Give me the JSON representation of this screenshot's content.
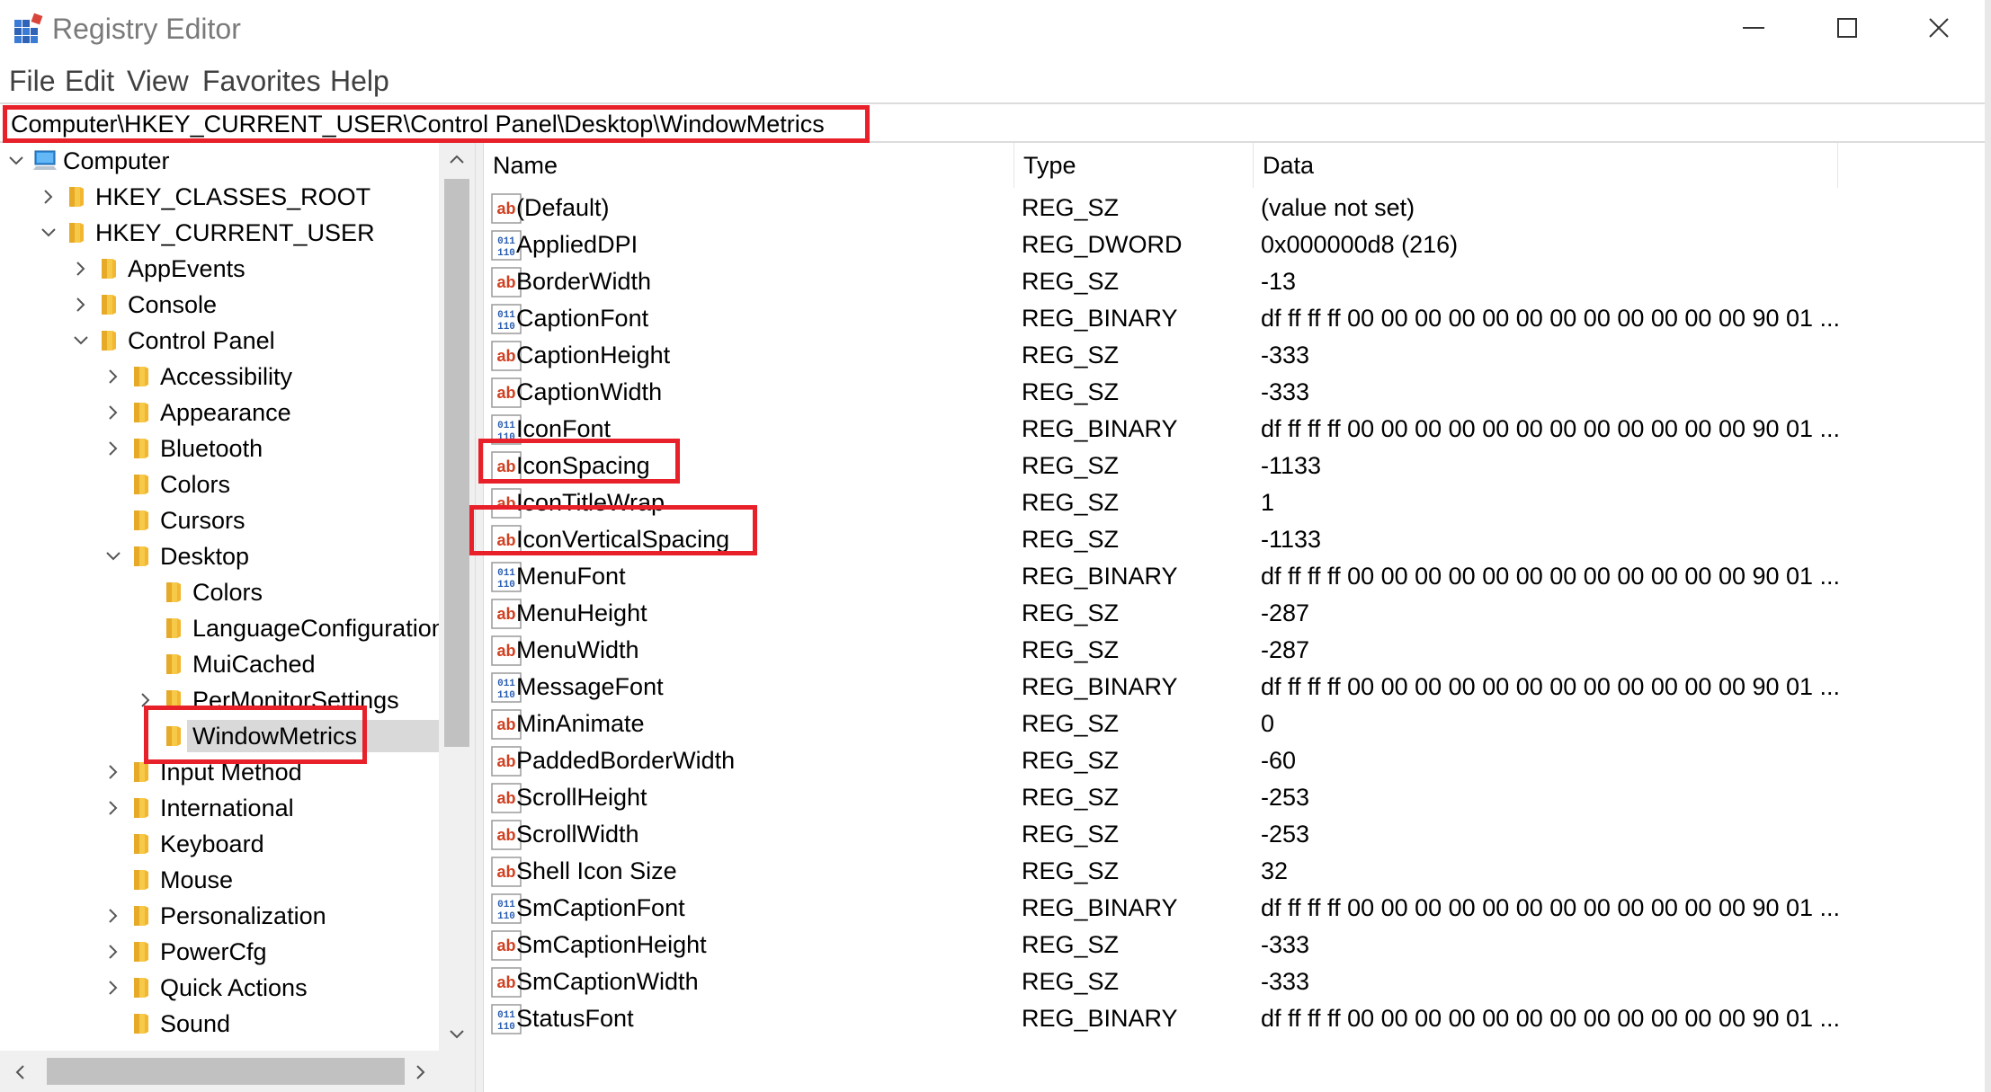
{
  "window": {
    "title": "Registry Editor",
    "accent": "#e8202a"
  },
  "menu": [
    "File",
    "Edit",
    "View",
    "Favorites",
    "Help"
  ],
  "address": "Computer\\HKEY_CURRENT_USER\\Control Panel\\Desktop\\WindowMetrics",
  "tree": [
    {
      "label": "Computer",
      "level": 0,
      "expander": "expanded",
      "icon": "computer-icon"
    },
    {
      "label": "HKEY_CLASSES_ROOT",
      "level": 1,
      "expander": "collapsed",
      "icon": "folder-icon"
    },
    {
      "label": "HKEY_CURRENT_USER",
      "level": 1,
      "expander": "expanded",
      "icon": "folder-icon"
    },
    {
      "label": "AppEvents",
      "level": 2,
      "expander": "collapsed",
      "icon": "folder-icon"
    },
    {
      "label": "Console",
      "level": 2,
      "expander": "collapsed",
      "icon": "folder-icon"
    },
    {
      "label": "Control Panel",
      "level": 2,
      "expander": "expanded",
      "icon": "folder-icon"
    },
    {
      "label": "Accessibility",
      "level": 3,
      "expander": "collapsed",
      "icon": "folder-icon"
    },
    {
      "label": "Appearance",
      "level": 3,
      "expander": "collapsed",
      "icon": "folder-icon"
    },
    {
      "label": "Bluetooth",
      "level": 3,
      "expander": "collapsed",
      "icon": "folder-icon"
    },
    {
      "label": "Colors",
      "level": 3,
      "expander": "none",
      "icon": "folder-icon"
    },
    {
      "label": "Cursors",
      "level": 3,
      "expander": "none",
      "icon": "folder-icon"
    },
    {
      "label": "Desktop",
      "level": 3,
      "expander": "expanded",
      "icon": "folder-icon"
    },
    {
      "label": "Colors",
      "level": 4,
      "expander": "none",
      "icon": "folder-icon"
    },
    {
      "label": "LanguageConfiguration",
      "level": 4,
      "expander": "none",
      "icon": "folder-icon"
    },
    {
      "label": "MuiCached",
      "level": 4,
      "expander": "none",
      "icon": "folder-icon"
    },
    {
      "label": "PerMonitorSettings",
      "level": 4,
      "expander": "collapsed",
      "icon": "folder-icon"
    },
    {
      "label": "WindowMetrics",
      "level": 4,
      "expander": "none",
      "icon": "folder-icon",
      "selected": true
    },
    {
      "label": "Input Method",
      "level": 3,
      "expander": "collapsed",
      "icon": "folder-icon"
    },
    {
      "label": "International",
      "level": 3,
      "expander": "collapsed",
      "icon": "folder-icon"
    },
    {
      "label": "Keyboard",
      "level": 3,
      "expander": "none",
      "icon": "folder-icon"
    },
    {
      "label": "Mouse",
      "level": 3,
      "expander": "none",
      "icon": "folder-icon"
    },
    {
      "label": "Personalization",
      "level": 3,
      "expander": "collapsed",
      "icon": "folder-icon"
    },
    {
      "label": "PowerCfg",
      "level": 3,
      "expander": "collapsed",
      "icon": "folder-icon"
    },
    {
      "label": "Quick Actions",
      "level": 3,
      "expander": "collapsed",
      "icon": "folder-icon"
    },
    {
      "label": "Sound",
      "level": 3,
      "expander": "none",
      "icon": "folder-icon"
    }
  ],
  "columns": {
    "name": "Name",
    "type": "Type",
    "data": "Data"
  },
  "values": [
    {
      "name": "(Default)",
      "type": "REG_SZ",
      "data": "(value not set)",
      "icon": "string-value-icon"
    },
    {
      "name": "AppliedDPI",
      "type": "REG_DWORD",
      "data": "0x000000d8 (216)",
      "icon": "binary-value-icon"
    },
    {
      "name": "BorderWidth",
      "type": "REG_SZ",
      "data": "-13",
      "icon": "string-value-icon"
    },
    {
      "name": "CaptionFont",
      "type": "REG_BINARY",
      "data": "df ff ff ff 00 00 00 00 00 00 00 00 00 00 00 00 90 01 ...",
      "icon": "binary-value-icon"
    },
    {
      "name": "CaptionHeight",
      "type": "REG_SZ",
      "data": "-333",
      "icon": "string-value-icon"
    },
    {
      "name": "CaptionWidth",
      "type": "REG_SZ",
      "data": "-333",
      "icon": "string-value-icon"
    },
    {
      "name": "IconFont",
      "type": "REG_BINARY",
      "data": "df ff ff ff 00 00 00 00 00 00 00 00 00 00 00 00 90 01 ...",
      "icon": "binary-value-icon"
    },
    {
      "name": "IconSpacing",
      "type": "REG_SZ",
      "data": "-1133",
      "icon": "string-value-icon"
    },
    {
      "name": "IconTitleWrap",
      "type": "REG_SZ",
      "data": "1",
      "icon": "string-value-icon"
    },
    {
      "name": "IconVerticalSpacing",
      "type": "REG_SZ",
      "data": "-1133",
      "icon": "string-value-icon"
    },
    {
      "name": "MenuFont",
      "type": "REG_BINARY",
      "data": "df ff ff ff 00 00 00 00 00 00 00 00 00 00 00 00 90 01 ...",
      "icon": "binary-value-icon"
    },
    {
      "name": "MenuHeight",
      "type": "REG_SZ",
      "data": "-287",
      "icon": "string-value-icon"
    },
    {
      "name": "MenuWidth",
      "type": "REG_SZ",
      "data": "-287",
      "icon": "string-value-icon"
    },
    {
      "name": "MessageFont",
      "type": "REG_BINARY",
      "data": "df ff ff ff 00 00 00 00 00 00 00 00 00 00 00 00 90 01 ...",
      "icon": "binary-value-icon"
    },
    {
      "name": "MinAnimate",
      "type": "REG_SZ",
      "data": "0",
      "icon": "string-value-icon"
    },
    {
      "name": "PaddedBorderWidth",
      "type": "REG_SZ",
      "data": "-60",
      "icon": "string-value-icon"
    },
    {
      "name": "ScrollHeight",
      "type": "REG_SZ",
      "data": "-253",
      "icon": "string-value-icon"
    },
    {
      "name": "ScrollWidth",
      "type": "REG_SZ",
      "data": "-253",
      "icon": "string-value-icon"
    },
    {
      "name": "Shell Icon Size",
      "type": "REG_SZ",
      "data": "32",
      "icon": "string-value-icon"
    },
    {
      "name": "SmCaptionFont",
      "type": "REG_BINARY",
      "data": "df ff ff ff 00 00 00 00 00 00 00 00 00 00 00 00 90 01 ...",
      "icon": "binary-value-icon"
    },
    {
      "name": "SmCaptionHeight",
      "type": "REG_SZ",
      "data": "-333",
      "icon": "string-value-icon"
    },
    {
      "name": "SmCaptionWidth",
      "type": "REG_SZ",
      "data": "-333",
      "icon": "string-value-icon"
    },
    {
      "name": "StatusFont",
      "type": "REG_BINARY",
      "data": "df ff ff ff 00 00 00 00 00 00 00 00 00 00 00 00 90 01 ...",
      "icon": "binary-value-icon"
    }
  ]
}
